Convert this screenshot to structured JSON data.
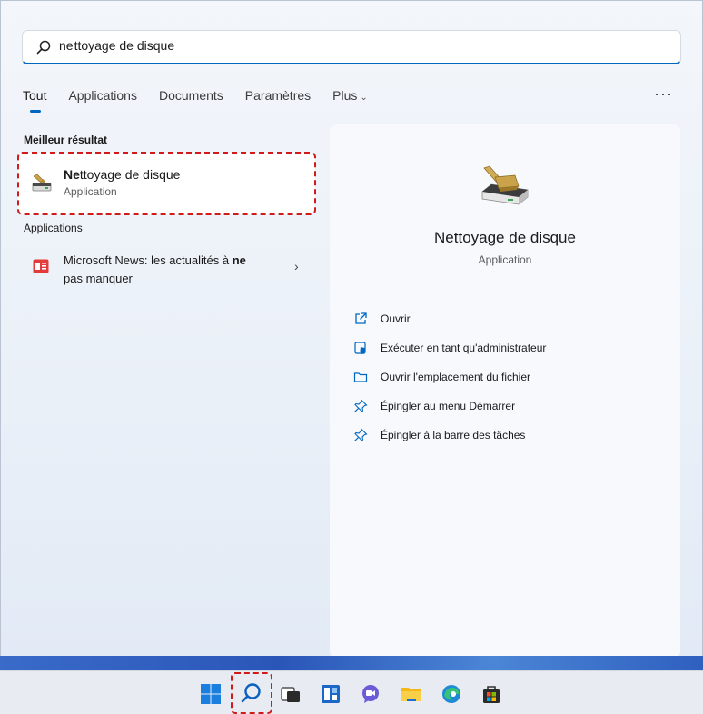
{
  "search": {
    "typed": "ne",
    "rest": "ttoyage de disque"
  },
  "tabs": [
    {
      "label": "Tout"
    },
    {
      "label": "Applications"
    },
    {
      "label": "Documents"
    },
    {
      "label": "Paramètres"
    },
    {
      "label": "Plus"
    }
  ],
  "more_menu_label": "···",
  "best_match": {
    "section_title": "Meilleur résultat",
    "name_bold": "Ne",
    "name_rest": "ttoyage de disque",
    "type": "Application"
  },
  "applications": {
    "section_title": "Applications",
    "items": [
      {
        "line1_prefix": "Microsoft News: les actualités à ",
        "line1_bold": "ne",
        "line2": "pas manquer"
      }
    ]
  },
  "detail": {
    "name": "Nettoyage de disque",
    "type": "Application",
    "actions": [
      {
        "label": "Ouvrir",
        "icon": "open-external-icon"
      },
      {
        "label": "Exécuter en tant qu'administrateur",
        "icon": "shield-run-admin-icon"
      },
      {
        "label": "Ouvrir l'emplacement du fichier",
        "icon": "folder-icon"
      },
      {
        "label": "Épingler au menu Démarrer",
        "icon": "pin-icon"
      },
      {
        "label": "Épingler à la barre des tâches",
        "icon": "pin-icon"
      }
    ]
  },
  "taskbar": {
    "items": [
      "start-icon",
      "search-icon",
      "task-view-icon",
      "widgets-icon",
      "teams-chat-icon",
      "file-explorer-icon",
      "edge-icon",
      "store-icon"
    ]
  },
  "colors": {
    "accent": "#0067c0",
    "highlight_dashed": "#d11a1a"
  }
}
